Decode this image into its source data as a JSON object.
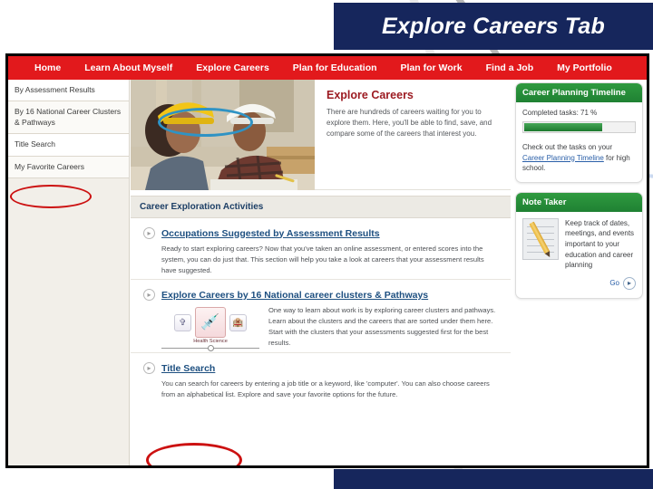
{
  "slide": {
    "title": "Explore Careers Tab"
  },
  "navbar": {
    "items": [
      {
        "label": "Home",
        "active": false
      },
      {
        "label": "Learn About Myself",
        "active": false
      },
      {
        "label": "Explore Careers",
        "active": true
      },
      {
        "label": "Plan for Education",
        "active": false
      },
      {
        "label": "Plan for Work",
        "active": false
      },
      {
        "label": "Find a Job",
        "active": false
      },
      {
        "label": "My Portfolio",
        "active": false
      }
    ]
  },
  "sidebar": {
    "items": [
      {
        "label": "By Assessment Results"
      },
      {
        "label": "By 16 National Career Clusters & Pathways"
      },
      {
        "label": "Title Search"
      },
      {
        "label": "My Favorite Careers"
      }
    ]
  },
  "hero": {
    "photo_alt": "two construction workers wearing hard hats reviewing blueprints",
    "heading": "Explore Careers",
    "body": "There are hundreds of careers waiting for you to explore them. Here, you'll be able to find, save, and compare some of the careers that interest you."
  },
  "section": {
    "header": "Career Exploration Activities"
  },
  "activities": [
    {
      "chevron_icon": "chevron-right-icon",
      "link": "Occupations Suggested by Assessment Results",
      "body": "Ready to start exploring careers? Now that you've taken an online assessment, or entered scores into the system, you can do just that. This section will help you take a look at careers that your assessment results have suggested."
    },
    {
      "chevron_icon": "chevron-right-icon",
      "link": "Explore Careers by 16 National career clusters & Pathways",
      "body": "One way to learn about work is by exploring career clusters and pathways. Learn about the clusters and the careers that are sorted under them here. Start with the clusters that your assessments suggested first for the best results."
    },
    {
      "chevron_icon": "chevron-right-icon",
      "link": "Title Search",
      "body": "You can search for careers by entering a job title or a keyword, like 'computer'. You can also choose careers from an alphabetical list. Explore and save your favorite options for the future."
    }
  ],
  "carousel": {
    "left_icon": "tools-cluster-icon",
    "center_icon": "health-science-cluster-icon",
    "right_icon": "hospitality-cluster-icon",
    "center_label": "Health Science",
    "rail_knob_icon": "carousel-knob-icon"
  },
  "panels": {
    "timeline": {
      "title": "Career Planning Timeline",
      "completed_label": "Completed tasks: 71 %",
      "progress_percent": 71,
      "note_before": "Check out the tasks on your",
      "note_link": "Career Planning Timeline",
      "note_after": " for high school."
    },
    "note_taker": {
      "title": "Note Taker",
      "icon": "notepad-pencil-icon",
      "body": "Keep track of dates, meetings, and events important to your education and career planning",
      "go_label": "Go",
      "go_icon": "chevron-right-icon"
    }
  },
  "annotations": {
    "blue_ellipse": "highlight-explore-careers-tab",
    "red_ellipse_sidebar": "highlight-title-search-sidebar",
    "red_ellipse_activity": "highlight-title-search-activity"
  },
  "colors": {
    "navbar_red": "#e2191c",
    "banner_navy": "#16265c",
    "panel_green": "#1f8133",
    "link_blue": "#1d4f80",
    "heading_maroon": "#9c1b22",
    "highlight_blue": "#2f93c4",
    "highlight_red": "#cc1111"
  }
}
